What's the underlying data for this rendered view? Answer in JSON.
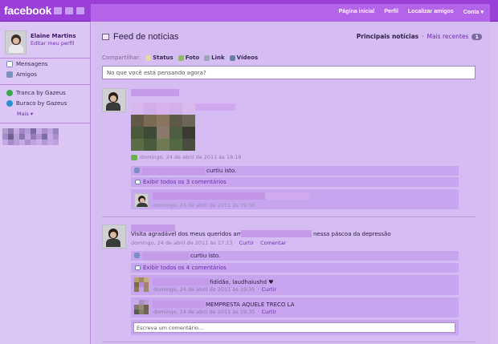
{
  "header": {
    "logo": "facebook",
    "nav": [
      "Página inicial",
      "Perfil",
      "Localizar amigos",
      "Conta ▾"
    ]
  },
  "sidebar": {
    "user_name": "Elaine Martins",
    "edit_profile": "Editar meu perfil",
    "items": [
      {
        "label": "Mensagens",
        "icon": "messages-icon"
      },
      {
        "label": "Amigos",
        "icon": "friends-icon"
      },
      {
        "label": "Tranca by Gazeus",
        "icon": "game-icon"
      },
      {
        "label": "Buraco by Gazeus",
        "icon": "game-icon"
      }
    ],
    "more": "Mais ▾"
  },
  "feed": {
    "title": "Feed de notícias",
    "top_news": "Principais notícias",
    "separator": "·",
    "recent": "Mais recentes",
    "recent_count": "1",
    "share_label": "Compartilhar:",
    "share_items": [
      "Status",
      "Foto",
      "Link",
      "Vídeos"
    ],
    "status_placeholder": "No que você está pensando agora?"
  },
  "post1": {
    "timestamp": "domingo, 24 de abril de 2011 às 18:18",
    "likes_suffix": "curtiu isto.",
    "view_comments": "Exibir todos os 3 comentários",
    "comment_time": "domingo, 24 de abril de 2011 às 19:35"
  },
  "post2": {
    "text_start": "Visita agradável dos meus queridos amigos",
    "text_end": "nessa páscoa da depressão",
    "timestamp": "domingo, 24 de abril de 2011 às 17:13",
    "like_action": "Curtir",
    "comment_action": "Comentar",
    "likes_suffix": "curtiu isto.",
    "view_comments": "Exibir todos os 4 comentários",
    "comments": [
      {
        "text": "fidídão, laudhaiushd ♥",
        "time": "domingo, 24 de abril de 2011 às 19:35",
        "action": "Curtir"
      },
      {
        "text": "MEMPRESTA AQUELE TRECO LA",
        "time": "domingo, 24 de abril de 2011 às 19:35",
        "action": "Curtir"
      }
    ],
    "write_comment": "Escreva um comentário..."
  },
  "colors": {
    "topbar": "#9a3fd8",
    "navbar": "#b364e8",
    "background": "#d8c1f2",
    "link": "#6b2bb0"
  }
}
